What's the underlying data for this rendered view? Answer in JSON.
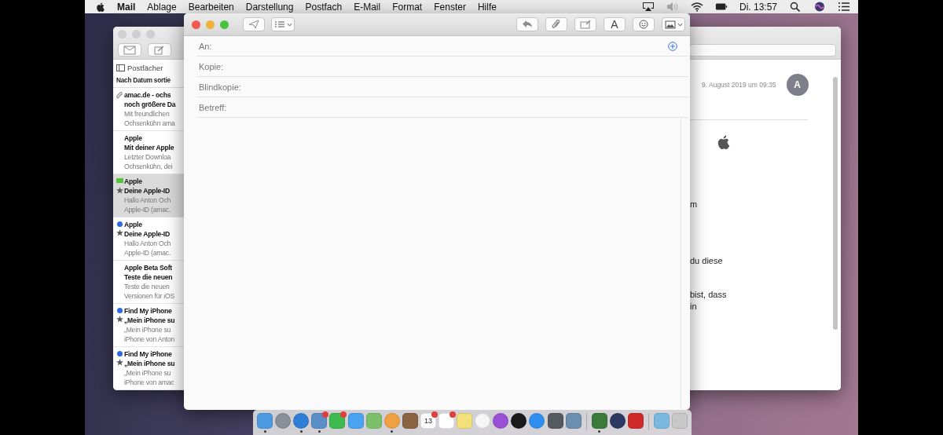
{
  "menu_bar": {
    "app": "Mail",
    "items": [
      "Ablage",
      "Bearbeiten",
      "Darstellung",
      "Postfach",
      "E-Mail",
      "Format",
      "Fenster",
      "Hilfe"
    ],
    "clock": "Di. 13:57"
  },
  "mail_window": {
    "mailboxes_button": "Postfächer",
    "sort_label": "Nach Datum sortie",
    "messages": [
      {
        "sender": "amac.de - ochs",
        "subject": "noch größere Da",
        "preview": [
          "Mit freundlichen",
          "Ochsenkühn ama"
        ],
        "unread": false,
        "flagged": false,
        "vip": false,
        "attachment": true,
        "selected": false
      },
      {
        "sender": "Apple",
        "subject": "Mit deiner Apple",
        "preview": [
          "Letzter Downloa",
          "Ochsenkühn, dei"
        ],
        "unread": false,
        "flagged": false,
        "vip": false,
        "attachment": false,
        "selected": false
      },
      {
        "sender": "Apple",
        "subject": "Deine Apple-ID",
        "preview": [
          "Hallo Anton Och",
          "Apple-ID (amac."
        ],
        "unread": false,
        "flagged": true,
        "vip": true,
        "attachment": false,
        "selected": true
      },
      {
        "sender": "Apple",
        "subject": "Deine Apple-ID",
        "preview": [
          "Hallo Anton Och",
          "Apple-ID (amac."
        ],
        "unread": true,
        "flagged": false,
        "vip": true,
        "attachment": false,
        "selected": false
      },
      {
        "sender": "Apple Beta Soft",
        "subject": "Teste die neuen",
        "preview": [
          "Teste die neuen",
          "Versionen für iOS"
        ],
        "unread": false,
        "flagged": false,
        "vip": false,
        "attachment": false,
        "selected": false
      },
      {
        "sender": "Find My iPhone",
        "subject": "„Mein iPhone su",
        "preview": [
          "„Mein iPhone su",
          "iPhone von Anton"
        ],
        "unread": true,
        "flagged": false,
        "vip": true,
        "attachment": false,
        "selected": false
      },
      {
        "sender": "Find My iPhone",
        "subject": "„Mein iPhone su",
        "preview": [
          "„Mein iPhone su",
          "iPhone von amac"
        ],
        "unread": true,
        "flagged": false,
        "vip": true,
        "attachment": false,
        "selected": false
      }
    ],
    "reader": {
      "date": "9. August 2019 um 09:35",
      "avatar": "A",
      "body": [
        "m",
        "du diese",
        "bist, dass",
        "in"
      ]
    }
  },
  "compose_window": {
    "font_button": "A",
    "fields": [
      {
        "label": "An:",
        "add_button": true
      },
      {
        "label": "Kopie:",
        "add_button": false
      },
      {
        "label": "Blindkopie:",
        "add_button": false
      },
      {
        "label": "Betreff:",
        "add_button": false
      }
    ]
  },
  "dock": {
    "items": [
      {
        "running": true,
        "badge": false
      },
      {
        "running": false,
        "badge": false
      },
      {
        "running": true,
        "badge": false
      },
      {
        "running": true,
        "badge": true
      },
      {
        "running": false,
        "badge": true
      },
      {
        "running": false,
        "badge": false
      },
      {
        "running": false,
        "badge": false
      },
      {
        "running": true,
        "badge": false
      },
      {
        "running": false,
        "badge": false
      },
      {
        "running": false,
        "badge": true,
        "label": "13"
      },
      {
        "running": false,
        "badge": true
      },
      {
        "running": false,
        "badge": false
      },
      {
        "running": false,
        "badge": false
      },
      {
        "running": false,
        "badge": false
      },
      {
        "running": false,
        "badge": false
      },
      {
        "running": false,
        "badge": false
      },
      {
        "running": false,
        "badge": false
      },
      {
        "running": false,
        "badge": false
      },
      {
        "running": true,
        "badge": false
      },
      {
        "running": false,
        "badge": false
      },
      {
        "running": false,
        "badge": false
      },
      {
        "running": false,
        "badge": false
      },
      {
        "running": false,
        "badge": false
      }
    ]
  }
}
